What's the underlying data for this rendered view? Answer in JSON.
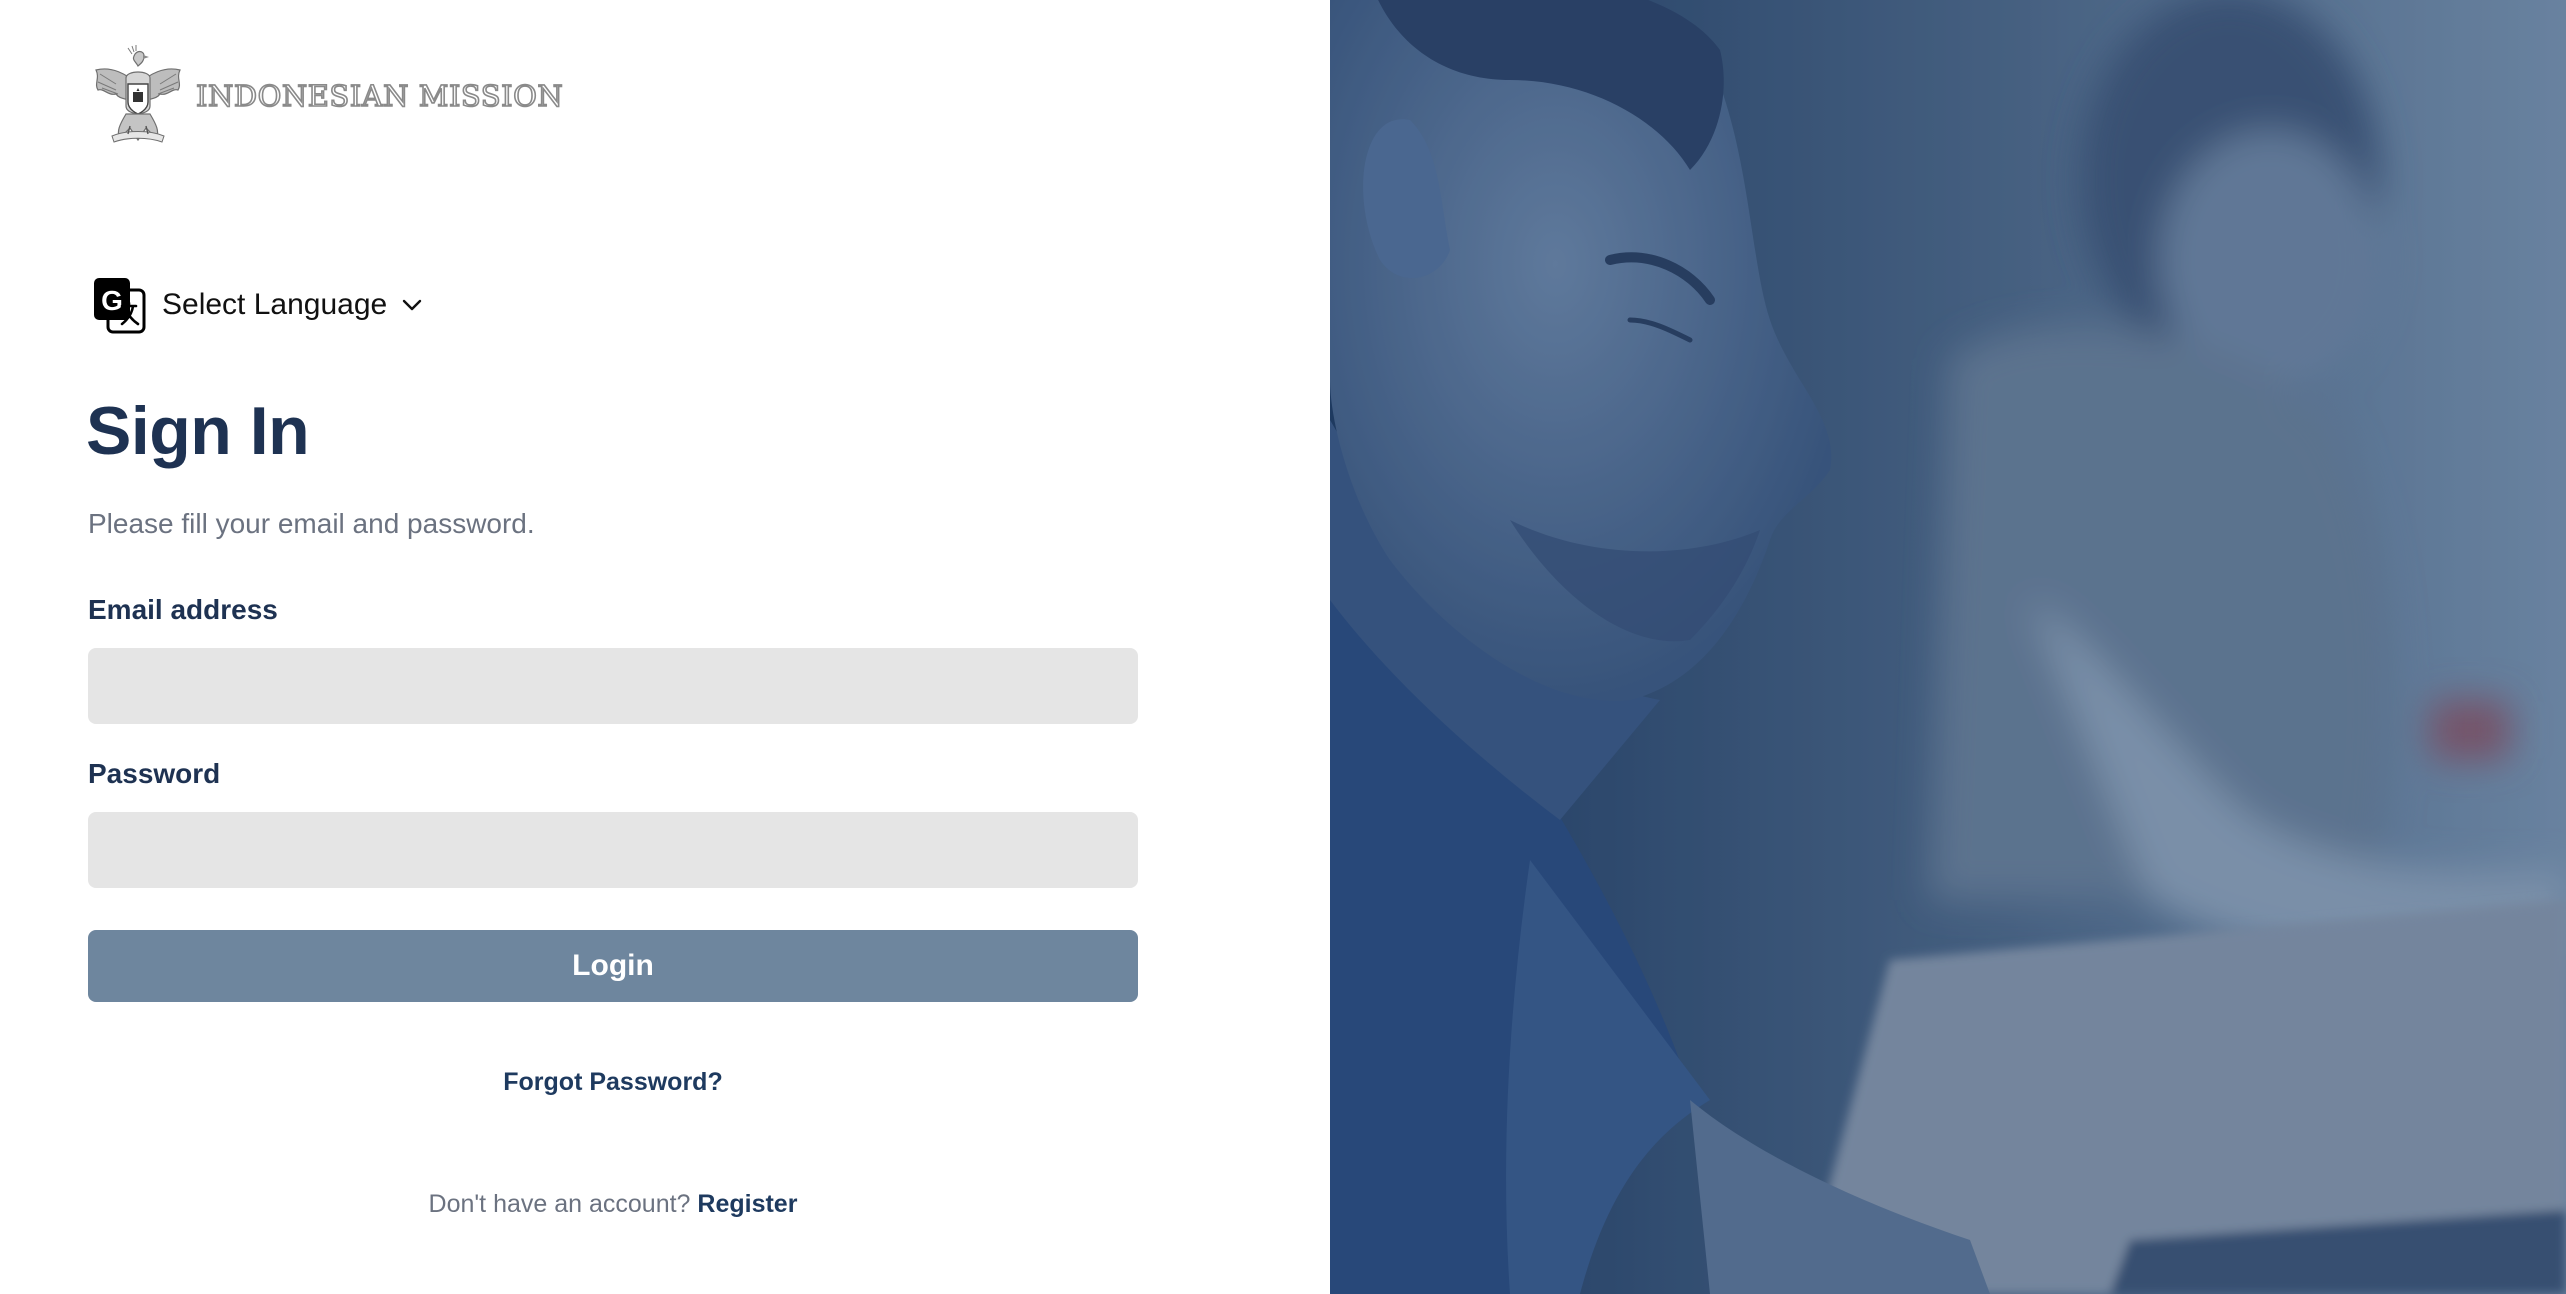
{
  "brand": {
    "logo_text": "INDONESIAN MISSION",
    "emblem_icon": "garuda-emblem-icon"
  },
  "language": {
    "icon": "google-translate-icon",
    "label": "Select Language",
    "chevron_icon": "chevron-down-icon"
  },
  "form": {
    "title": "Sign In",
    "subtitle": "Please fill your email and password.",
    "email_label": "Email address",
    "email_value": "",
    "password_label": "Password",
    "password_value": "",
    "login_label": "Login",
    "forgot_label": "Forgot Password?",
    "no_account_text": "Don't have an account?",
    "register_label": "Register"
  },
  "colors": {
    "heading": "#1e3252",
    "login_button": "#6e869e",
    "input_background": "#e5e5e5",
    "hero_overlay": "#2c4a6e"
  }
}
